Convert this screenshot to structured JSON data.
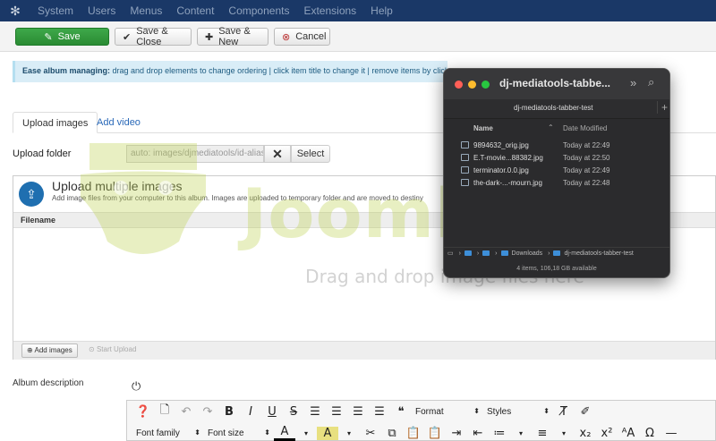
{
  "topnav": {
    "items": [
      "System",
      "Users",
      "Menus",
      "Content",
      "Components",
      "Extensions",
      "Help"
    ]
  },
  "toolbar": {
    "save": "Save",
    "save_close": "Save & Close",
    "save_new": "Save & New",
    "cancel": "Cancel"
  },
  "info": {
    "bold": "Ease album managing:",
    "text": " drag and drop elements to change ordering | click item title to change it | remove items by clicking the cross icon"
  },
  "tabs": {
    "upload": "Upload images",
    "video": "Add video"
  },
  "upload_folder": {
    "label": "Upload folder",
    "value": "auto: images/djmediatools/id-alias",
    "select": "Select"
  },
  "uploader": {
    "title": "Upload multiple images",
    "subtitle": "Add image files from your computer to this album. Images are uploaded to temporary folder and are moved to destiny",
    "col_filename": "Filename",
    "drop_text": "Drag and drop image files here",
    "add_images": "Add images",
    "start_upload": "Start Upload"
  },
  "album_description": {
    "label": "Album description"
  },
  "editor": {
    "format": "Format",
    "styles": "Styles",
    "font_family": "Font family",
    "font_size": "Font size"
  },
  "finder": {
    "title": "dj-mediatools-tabbe...",
    "tab": "dj-mediatools-tabber-test",
    "col_name": "Name",
    "col_date": "Date Modified",
    "files": [
      {
        "name": "9894632_orig.jpg",
        "date": "Today at 22:49"
      },
      {
        "name": "E.T-movie...88382.jpg",
        "date": "Today at 22:50"
      },
      {
        "name": "terminator.0.0.jpg",
        "date": "Today at 22:49"
      },
      {
        "name": "the-dark-...-mourn.jpg",
        "date": "Today at 22:48"
      }
    ],
    "path_downloads": "Downloads",
    "path_folder": "dj-mediatools-tabber-test",
    "status": "4 items, 106,18 GB available"
  },
  "watermark": {
    "text": "Joomla.bid"
  },
  "colors": {
    "nav_bg": "#1a3867",
    "save_green": "#2f9a3b",
    "finder_bg": "#2b2b2d"
  }
}
